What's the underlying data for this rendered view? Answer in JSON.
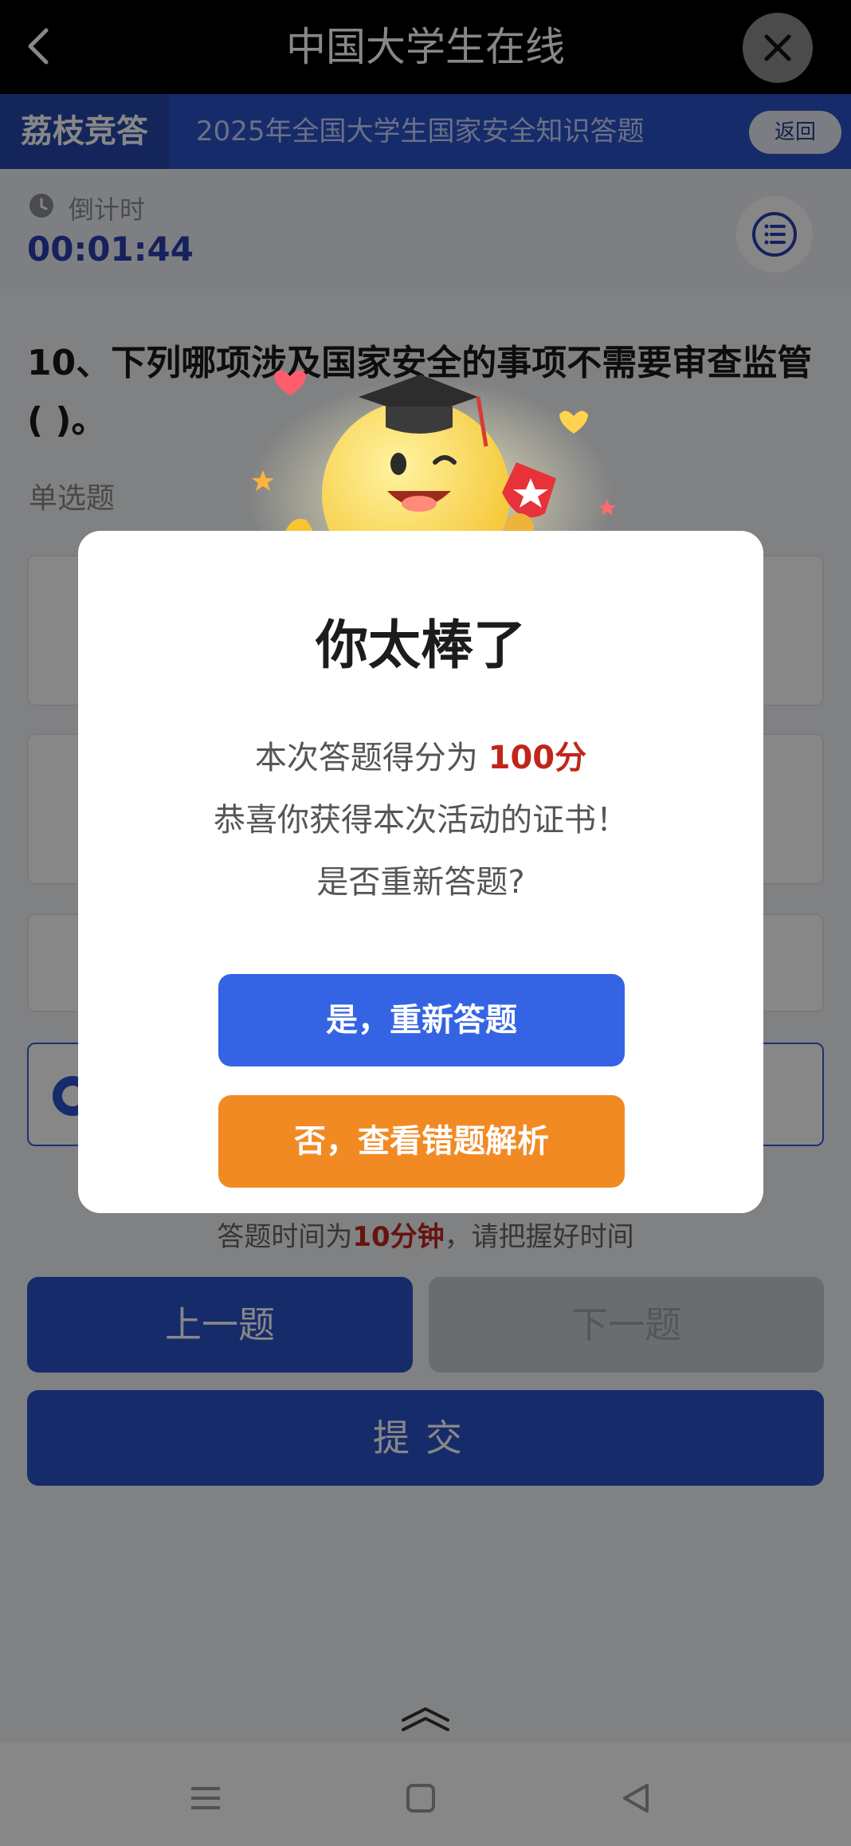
{
  "app_bar": {
    "title": "中国大学生在线"
  },
  "sub_header": {
    "brand": "荔枝竞答",
    "title": "2025年全国大学生国家安全知识答题",
    "return_label": "返回"
  },
  "timer": {
    "label": "倒计时",
    "value": "00:01:44"
  },
  "question": {
    "text": "10、下列哪项涉及国家安全的事项不需要审查监管( )。",
    "type": "单选题"
  },
  "hint": {
    "prefix": "答题时间为",
    "highlight": "10分钟",
    "suffix": "，请把握好时间"
  },
  "buttons": {
    "prev": "上一题",
    "next": "下一题",
    "submit": "提交"
  },
  "dialog": {
    "title": "你太棒了",
    "score_prefix": "本次答题得分为 ",
    "score": "100分",
    "line2": "恭喜你获得本次活动的证书！",
    "line3": "是否重新答题?",
    "yes_label": "是，重新答题",
    "no_label": "否，查看错题解析"
  },
  "colors": {
    "primary": "#2b52c9",
    "accent_orange": "#f28a24",
    "score_red": "#c0261b"
  },
  "icons": [
    "back-arrow-icon",
    "close-icon",
    "clock-icon",
    "list-icon",
    "swipe-up-icon",
    "menu-nav-icon",
    "home-nav-icon",
    "back-nav-icon"
  ]
}
